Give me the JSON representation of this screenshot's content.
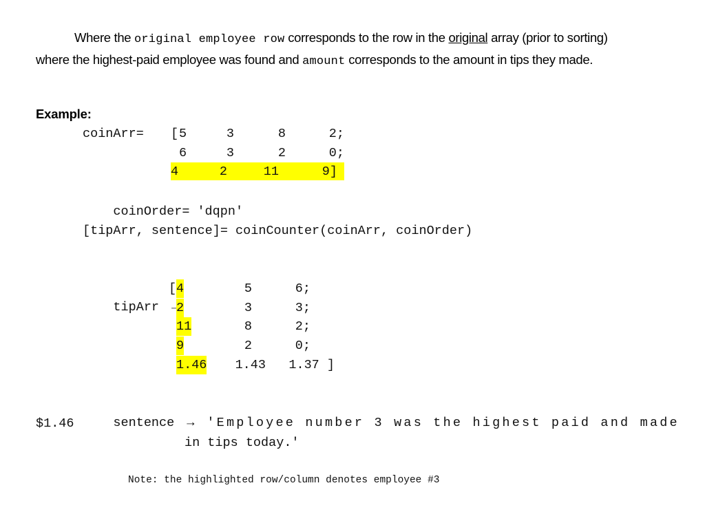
{
  "document": {
    "paragraph": {
      "lead_indent": true,
      "seg1": "Where the ",
      "code1": "original employee row",
      "seg2": "  corresponds to the row in the ",
      "underlined": "original",
      "seg3": " array (prior to sorting) where the highest-paid employee was found and ",
      "code2": "amount",
      "seg4": "  corresponds to the amount in tips they made."
    },
    "example_heading": "Example:",
    "coin_arr": {
      "label": "coinArr=",
      "open_bracket": "[",
      "rows": [
        {
          "cells": [
            "5",
            "3",
            "8",
            "2;"
          ],
          "highlighted": false
        },
        {
          "cells": [
            "6",
            "3",
            "2",
            "0;"
          ],
          "highlighted": false
        },
        {
          "cells": [
            "4",
            "2",
            "11",
            "9]"
          ],
          "highlighted": true
        }
      ]
    },
    "coin_order": {
      "label": "coinOrder=",
      "value": "'dqpn'"
    },
    "call_line": "[tipArr, sentence]= coinCounter(coinArr, coinOrder)",
    "tip_arr": {
      "label": "tipArr",
      "arrow": "→",
      "open_bracket": "[",
      "rows": [
        {
          "cells": [
            "4",
            "5",
            "6;"
          ],
          "highlight_col0": true
        },
        {
          "cells": [
            "2",
            "3",
            "3;"
          ],
          "highlight_col0": true
        },
        {
          "cells": [
            "11",
            "8",
            "2;"
          ],
          "highlight_col0": true
        },
        {
          "cells": [
            "9",
            "2",
            "0;"
          ],
          "highlight_col0": true
        },
        {
          "cells": [
            "1.46",
            "1.43",
            "1.37 ]"
          ],
          "highlight_col0": true
        }
      ]
    },
    "sentence_output": {
      "label": "sentence",
      "arrow": "→",
      "line1": "'Employee number 3 was the highest paid and made",
      "line2": "$1.46",
      "line3": "in tips today.'"
    },
    "note": "Note: the highlighted row/column denotes employee #3"
  },
  "colors": {
    "highlight": "#FFFF00",
    "text": "#000000",
    "background": "#FFFFFF"
  }
}
